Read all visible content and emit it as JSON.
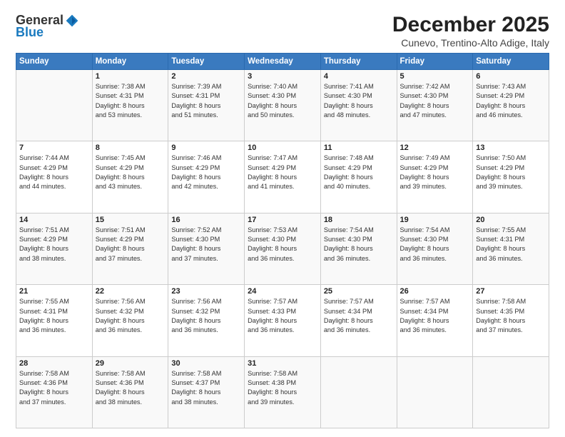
{
  "logo": {
    "general": "General",
    "blue": "Blue"
  },
  "title": "December 2025",
  "location": "Cunevo, Trentino-Alto Adige, Italy",
  "days_of_week": [
    "Sunday",
    "Monday",
    "Tuesday",
    "Wednesday",
    "Thursday",
    "Friday",
    "Saturday"
  ],
  "weeks": [
    [
      {
        "day": "",
        "info": ""
      },
      {
        "day": "1",
        "info": "Sunrise: 7:38 AM\nSunset: 4:31 PM\nDaylight: 8 hours\nand 53 minutes."
      },
      {
        "day": "2",
        "info": "Sunrise: 7:39 AM\nSunset: 4:31 PM\nDaylight: 8 hours\nand 51 minutes."
      },
      {
        "day": "3",
        "info": "Sunrise: 7:40 AM\nSunset: 4:30 PM\nDaylight: 8 hours\nand 50 minutes."
      },
      {
        "day": "4",
        "info": "Sunrise: 7:41 AM\nSunset: 4:30 PM\nDaylight: 8 hours\nand 48 minutes."
      },
      {
        "day": "5",
        "info": "Sunrise: 7:42 AM\nSunset: 4:30 PM\nDaylight: 8 hours\nand 47 minutes."
      },
      {
        "day": "6",
        "info": "Sunrise: 7:43 AM\nSunset: 4:29 PM\nDaylight: 8 hours\nand 46 minutes."
      }
    ],
    [
      {
        "day": "7",
        "info": "Sunrise: 7:44 AM\nSunset: 4:29 PM\nDaylight: 8 hours\nand 44 minutes."
      },
      {
        "day": "8",
        "info": "Sunrise: 7:45 AM\nSunset: 4:29 PM\nDaylight: 8 hours\nand 43 minutes."
      },
      {
        "day": "9",
        "info": "Sunrise: 7:46 AM\nSunset: 4:29 PM\nDaylight: 8 hours\nand 42 minutes."
      },
      {
        "day": "10",
        "info": "Sunrise: 7:47 AM\nSunset: 4:29 PM\nDaylight: 8 hours\nand 41 minutes."
      },
      {
        "day": "11",
        "info": "Sunrise: 7:48 AM\nSunset: 4:29 PM\nDaylight: 8 hours\nand 40 minutes."
      },
      {
        "day": "12",
        "info": "Sunrise: 7:49 AM\nSunset: 4:29 PM\nDaylight: 8 hours\nand 39 minutes."
      },
      {
        "day": "13",
        "info": "Sunrise: 7:50 AM\nSunset: 4:29 PM\nDaylight: 8 hours\nand 39 minutes."
      }
    ],
    [
      {
        "day": "14",
        "info": "Sunrise: 7:51 AM\nSunset: 4:29 PM\nDaylight: 8 hours\nand 38 minutes."
      },
      {
        "day": "15",
        "info": "Sunrise: 7:51 AM\nSunset: 4:29 PM\nDaylight: 8 hours\nand 37 minutes."
      },
      {
        "day": "16",
        "info": "Sunrise: 7:52 AM\nSunset: 4:30 PM\nDaylight: 8 hours\nand 37 minutes."
      },
      {
        "day": "17",
        "info": "Sunrise: 7:53 AM\nSunset: 4:30 PM\nDaylight: 8 hours\nand 36 minutes."
      },
      {
        "day": "18",
        "info": "Sunrise: 7:54 AM\nSunset: 4:30 PM\nDaylight: 8 hours\nand 36 minutes."
      },
      {
        "day": "19",
        "info": "Sunrise: 7:54 AM\nSunset: 4:30 PM\nDaylight: 8 hours\nand 36 minutes."
      },
      {
        "day": "20",
        "info": "Sunrise: 7:55 AM\nSunset: 4:31 PM\nDaylight: 8 hours\nand 36 minutes."
      }
    ],
    [
      {
        "day": "21",
        "info": "Sunrise: 7:55 AM\nSunset: 4:31 PM\nDaylight: 8 hours\nand 36 minutes."
      },
      {
        "day": "22",
        "info": "Sunrise: 7:56 AM\nSunset: 4:32 PM\nDaylight: 8 hours\nand 36 minutes."
      },
      {
        "day": "23",
        "info": "Sunrise: 7:56 AM\nSunset: 4:32 PM\nDaylight: 8 hours\nand 36 minutes."
      },
      {
        "day": "24",
        "info": "Sunrise: 7:57 AM\nSunset: 4:33 PM\nDaylight: 8 hours\nand 36 minutes."
      },
      {
        "day": "25",
        "info": "Sunrise: 7:57 AM\nSunset: 4:34 PM\nDaylight: 8 hours\nand 36 minutes."
      },
      {
        "day": "26",
        "info": "Sunrise: 7:57 AM\nSunset: 4:34 PM\nDaylight: 8 hours\nand 36 minutes."
      },
      {
        "day": "27",
        "info": "Sunrise: 7:58 AM\nSunset: 4:35 PM\nDaylight: 8 hours\nand 37 minutes."
      }
    ],
    [
      {
        "day": "28",
        "info": "Sunrise: 7:58 AM\nSunset: 4:36 PM\nDaylight: 8 hours\nand 37 minutes."
      },
      {
        "day": "29",
        "info": "Sunrise: 7:58 AM\nSunset: 4:36 PM\nDaylight: 8 hours\nand 38 minutes."
      },
      {
        "day": "30",
        "info": "Sunrise: 7:58 AM\nSunset: 4:37 PM\nDaylight: 8 hours\nand 38 minutes."
      },
      {
        "day": "31",
        "info": "Sunrise: 7:58 AM\nSunset: 4:38 PM\nDaylight: 8 hours\nand 39 minutes."
      },
      {
        "day": "",
        "info": ""
      },
      {
        "day": "",
        "info": ""
      },
      {
        "day": "",
        "info": ""
      }
    ]
  ]
}
